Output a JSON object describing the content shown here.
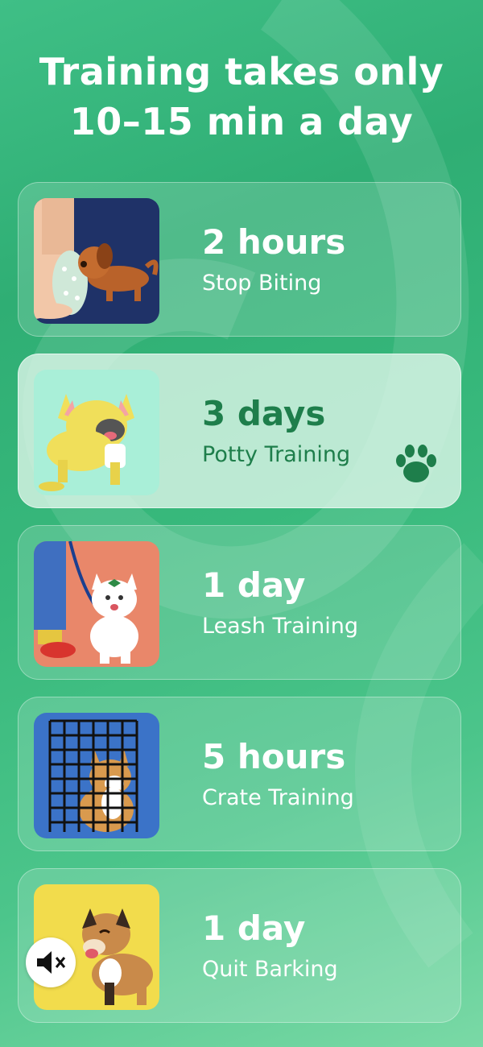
{
  "title_line1": "Training takes only",
  "title_line2": "10–15 min a day",
  "colors": {
    "accent": "#1e7e4b",
    "background": "#38b97c"
  },
  "items": [
    {
      "duration": "2 hours",
      "label": "Stop Biting",
      "selected": false
    },
    {
      "duration": "3 days",
      "label": "Potty Training",
      "selected": true
    },
    {
      "duration": "1 day",
      "label": "Leash Training",
      "selected": false
    },
    {
      "duration": "5 hours",
      "label": "Crate Training",
      "selected": false
    },
    {
      "duration": "1 day",
      "label": "Quit Barking",
      "selected": false
    }
  ],
  "icons": {
    "selected_marker": "paw-icon",
    "sound": "mute-icon"
  }
}
